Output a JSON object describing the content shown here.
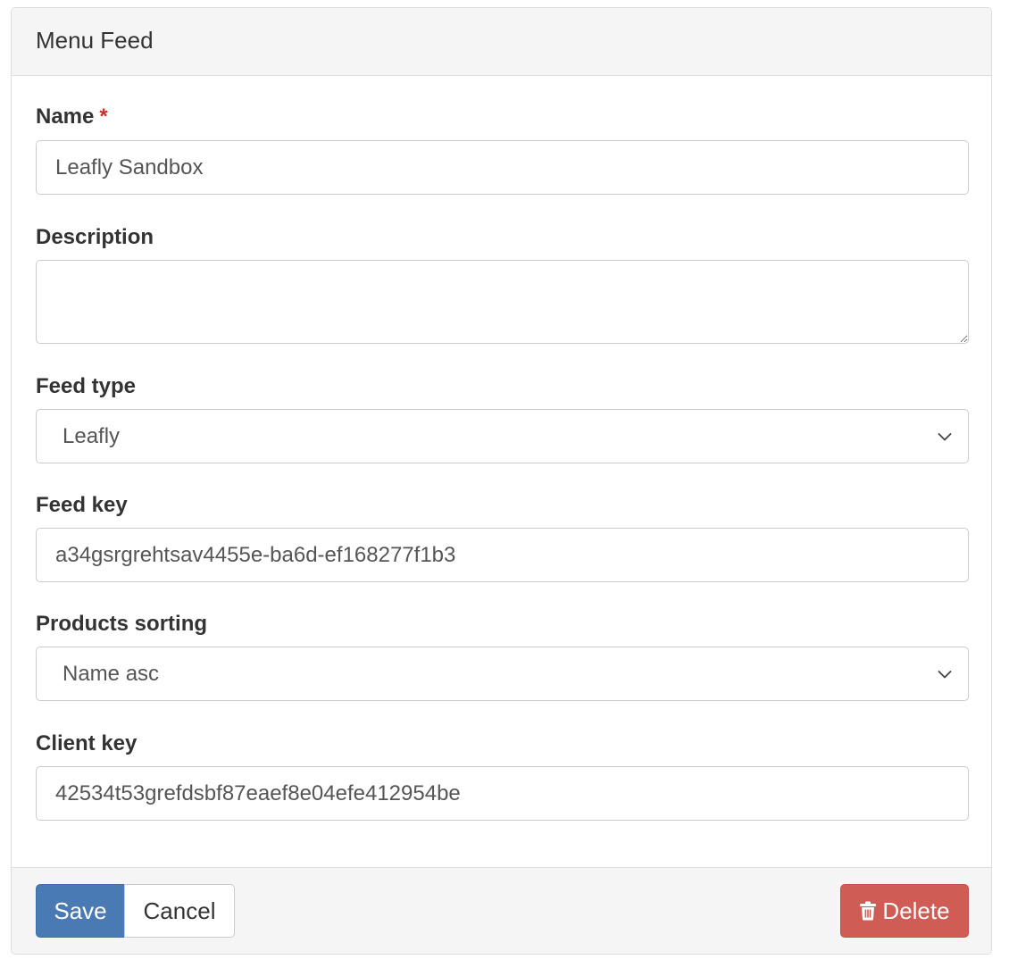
{
  "panel": {
    "title": "Menu Feed"
  },
  "form": {
    "name": {
      "label": "Name",
      "required_marker": "*",
      "value": "Leafly Sandbox"
    },
    "description": {
      "label": "Description",
      "value": ""
    },
    "feed_type": {
      "label": "Feed type",
      "selected": "Leafly"
    },
    "feed_key": {
      "label": "Feed key",
      "value": "a34gsrgrehtsav4455e-ba6d-ef168277f1b3"
    },
    "products_sorting": {
      "label": "Products sorting",
      "selected": "Name asc"
    },
    "client_key": {
      "label": "Client key",
      "value": "42534t53grefdsbf87eaef8e04efe412954be"
    }
  },
  "footer": {
    "save_label": "Save",
    "cancel_label": "Cancel",
    "delete_label": "Delete"
  },
  "icons": {
    "select_arrow": "chevron-down-icon",
    "delete": "trash-icon"
  },
  "colors": {
    "primary": "#4a7ab3",
    "danger": "#cf5c55",
    "required": "#c9302c",
    "panel_header_bg": "#f5f5f5"
  }
}
